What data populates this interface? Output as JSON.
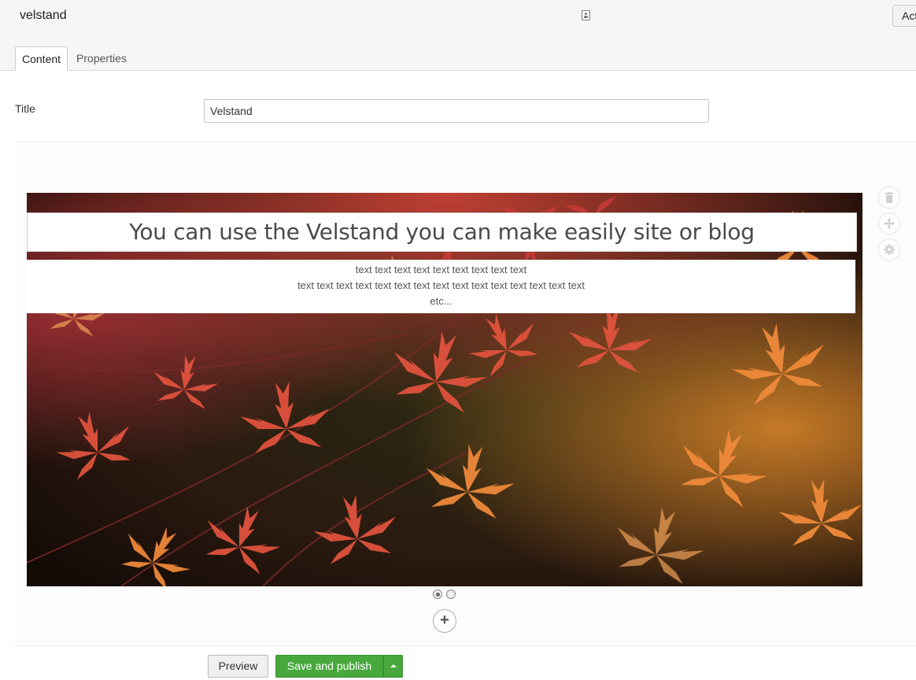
{
  "header": {
    "doc_name": "velstand",
    "doc_type_icon": "id-card-icon",
    "actions_label": "Act"
  },
  "tabs": [
    {
      "label": "Content",
      "active": true
    },
    {
      "label": "Properties",
      "active": false
    }
  ],
  "form": {
    "title_label": "Title",
    "title_value": "Velstand"
  },
  "slide": {
    "headline": "You can use the Velstand you can make easily site or blog",
    "body_lines": [
      "text text text text text text text text text",
      "text text text text text text text text text text text text text text text",
      "etc..."
    ],
    "image_subject": "autumn red maple leaves",
    "slide_count": 2,
    "active_slide": 1
  },
  "side_controls": [
    {
      "name": "delete",
      "icon": "trash-icon"
    },
    {
      "name": "move",
      "icon": "move-icon"
    },
    {
      "name": "settings",
      "icon": "gear-icon"
    }
  ],
  "footer": {
    "preview_label": "Preview",
    "publish_label": "Save and publish"
  },
  "colors": {
    "publish_green": "#48a83e",
    "header_bg": "#f6f6f6"
  }
}
